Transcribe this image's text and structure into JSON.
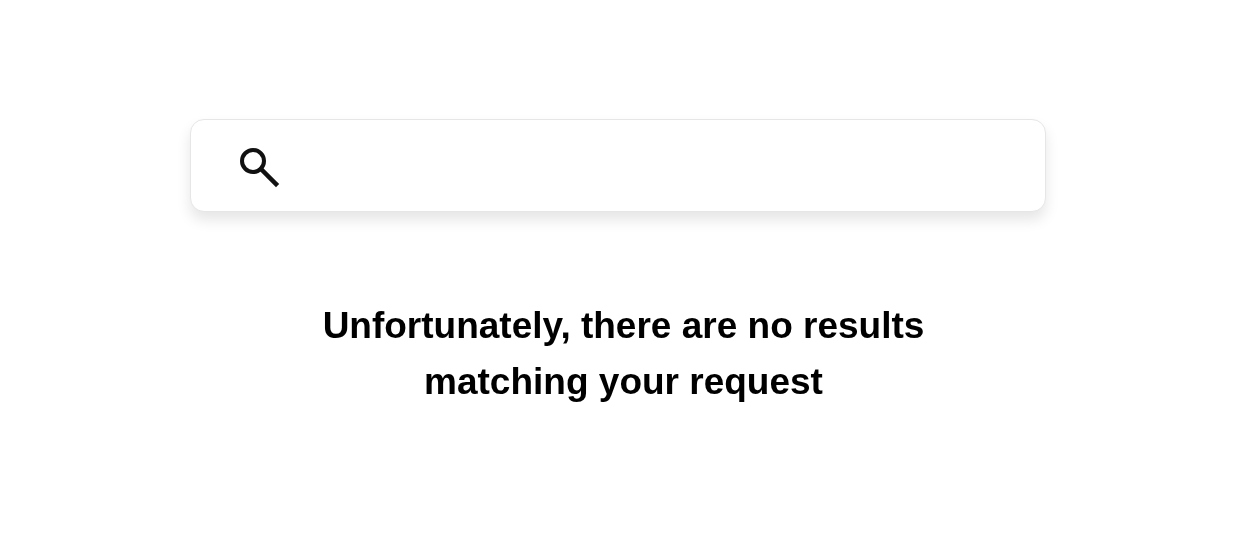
{
  "search": {
    "kind": "search"
  },
  "message": "Unfortunately, there are no results matching your request"
}
